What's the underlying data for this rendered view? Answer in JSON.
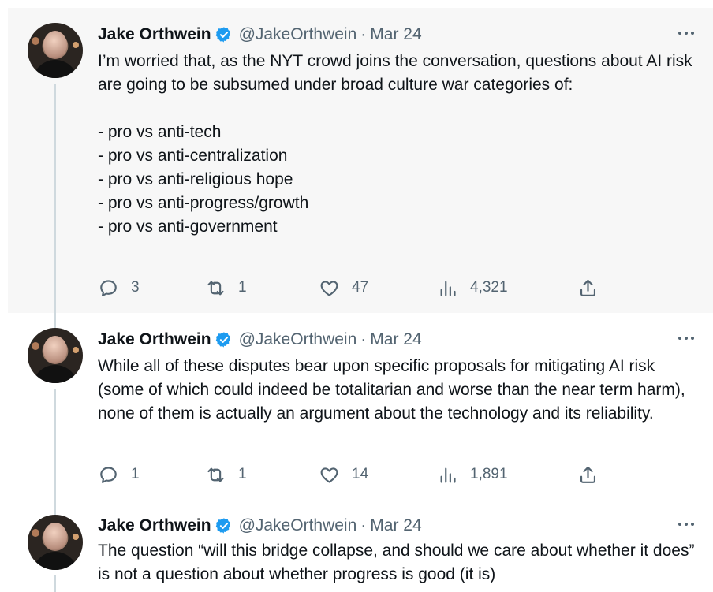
{
  "colors": {
    "accent": "#1d9bf0",
    "text": "#0f1419",
    "muted": "#536471",
    "highlight_bg": "#f7f7f7"
  },
  "tweets": [
    {
      "author_name": "Jake Orthwein",
      "handle": "@JakeOrthwein",
      "separator": "·",
      "date": "Mar 24",
      "text": "I’m worried that, as the NYT crowd joins the conversation, questions about AI risk are going to be subsumed under broad culture war categories of:\n\n- pro vs anti-tech\n- pro vs anti-centralization\n- pro vs anti-religious hope\n- pro vs anti-progress/growth\n- pro vs anti-government",
      "replies": "3",
      "retweets": "1",
      "likes": "47",
      "views": "4,321"
    },
    {
      "author_name": "Jake Orthwein",
      "handle": "@JakeOrthwein",
      "separator": "·",
      "date": "Mar 24",
      "text": "While all of these disputes bear upon specific proposals for mitigating AI risk (some of which could indeed be totalitarian and worse than the near term harm), none of them is actually an argument about the technology and its reliability.",
      "replies": "1",
      "retweets": "1",
      "likes": "14",
      "views": "1,891"
    },
    {
      "author_name": "Jake Orthwein",
      "handle": "@JakeOrthwein",
      "separator": "·",
      "date": "Mar 24",
      "text": "The question “will this bridge collapse, and should we care about whether it does” is not a question about whether progress is good (it is)"
    }
  ]
}
